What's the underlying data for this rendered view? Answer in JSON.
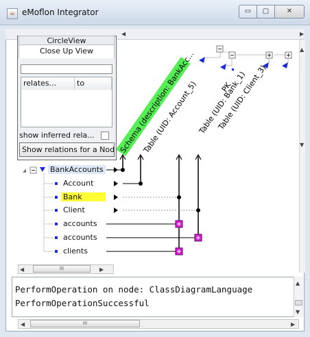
{
  "window": {
    "title": "eMoflon Integrator",
    "app_icon": "java-coffee-icon",
    "buttons": {
      "minimize": "▭",
      "maximize": "▢",
      "close": "✕"
    }
  },
  "left_panel": {
    "tabs": [
      "CircleView",
      "Close Up View"
    ],
    "selected_tab": "Close Up View",
    "filter_value": "",
    "table_headers": [
      "relates...",
      "to"
    ],
    "checkbox_label": "show inferred rela...",
    "checkbox_checked": false,
    "button_label": "Show relations for a Nod"
  },
  "diagram": {
    "headers": [
      {
        "label": "Schema (description: BankAcc...",
        "highlight": true
      },
      {
        "label": "Table (UID: Account_5)",
        "highlight": false
      },
      {
        "label": "PK",
        "highlight": false
      },
      {
        "label": "Table (UID: Bank_1)",
        "highlight": false
      },
      {
        "label": "Table (UID: Client_3)",
        "highlight": false
      }
    ],
    "tree": [
      {
        "label": "BankAccounts",
        "level": 0,
        "expanded": true,
        "root": true
      },
      {
        "label": "Account",
        "level": 1
      },
      {
        "label": "Bank",
        "level": 1,
        "highlight": true
      },
      {
        "label": "Client",
        "level": 1
      },
      {
        "label": "accounts",
        "level": 1
      },
      {
        "label": "accounts",
        "level": 1
      },
      {
        "label": "clients",
        "level": 1
      }
    ],
    "colors": {
      "highlight_green": "#55ee55",
      "highlight_yellow": "#ffff33",
      "node_magenta": "#cc22cc",
      "icon_blue": "#1a2ad6"
    }
  },
  "console": {
    "lines": [
      "PerformOperation on node: ClassDiagramLanguage",
      "PerformOperationSuccessful"
    ],
    "scroll_thumb_glyph": "III"
  }
}
